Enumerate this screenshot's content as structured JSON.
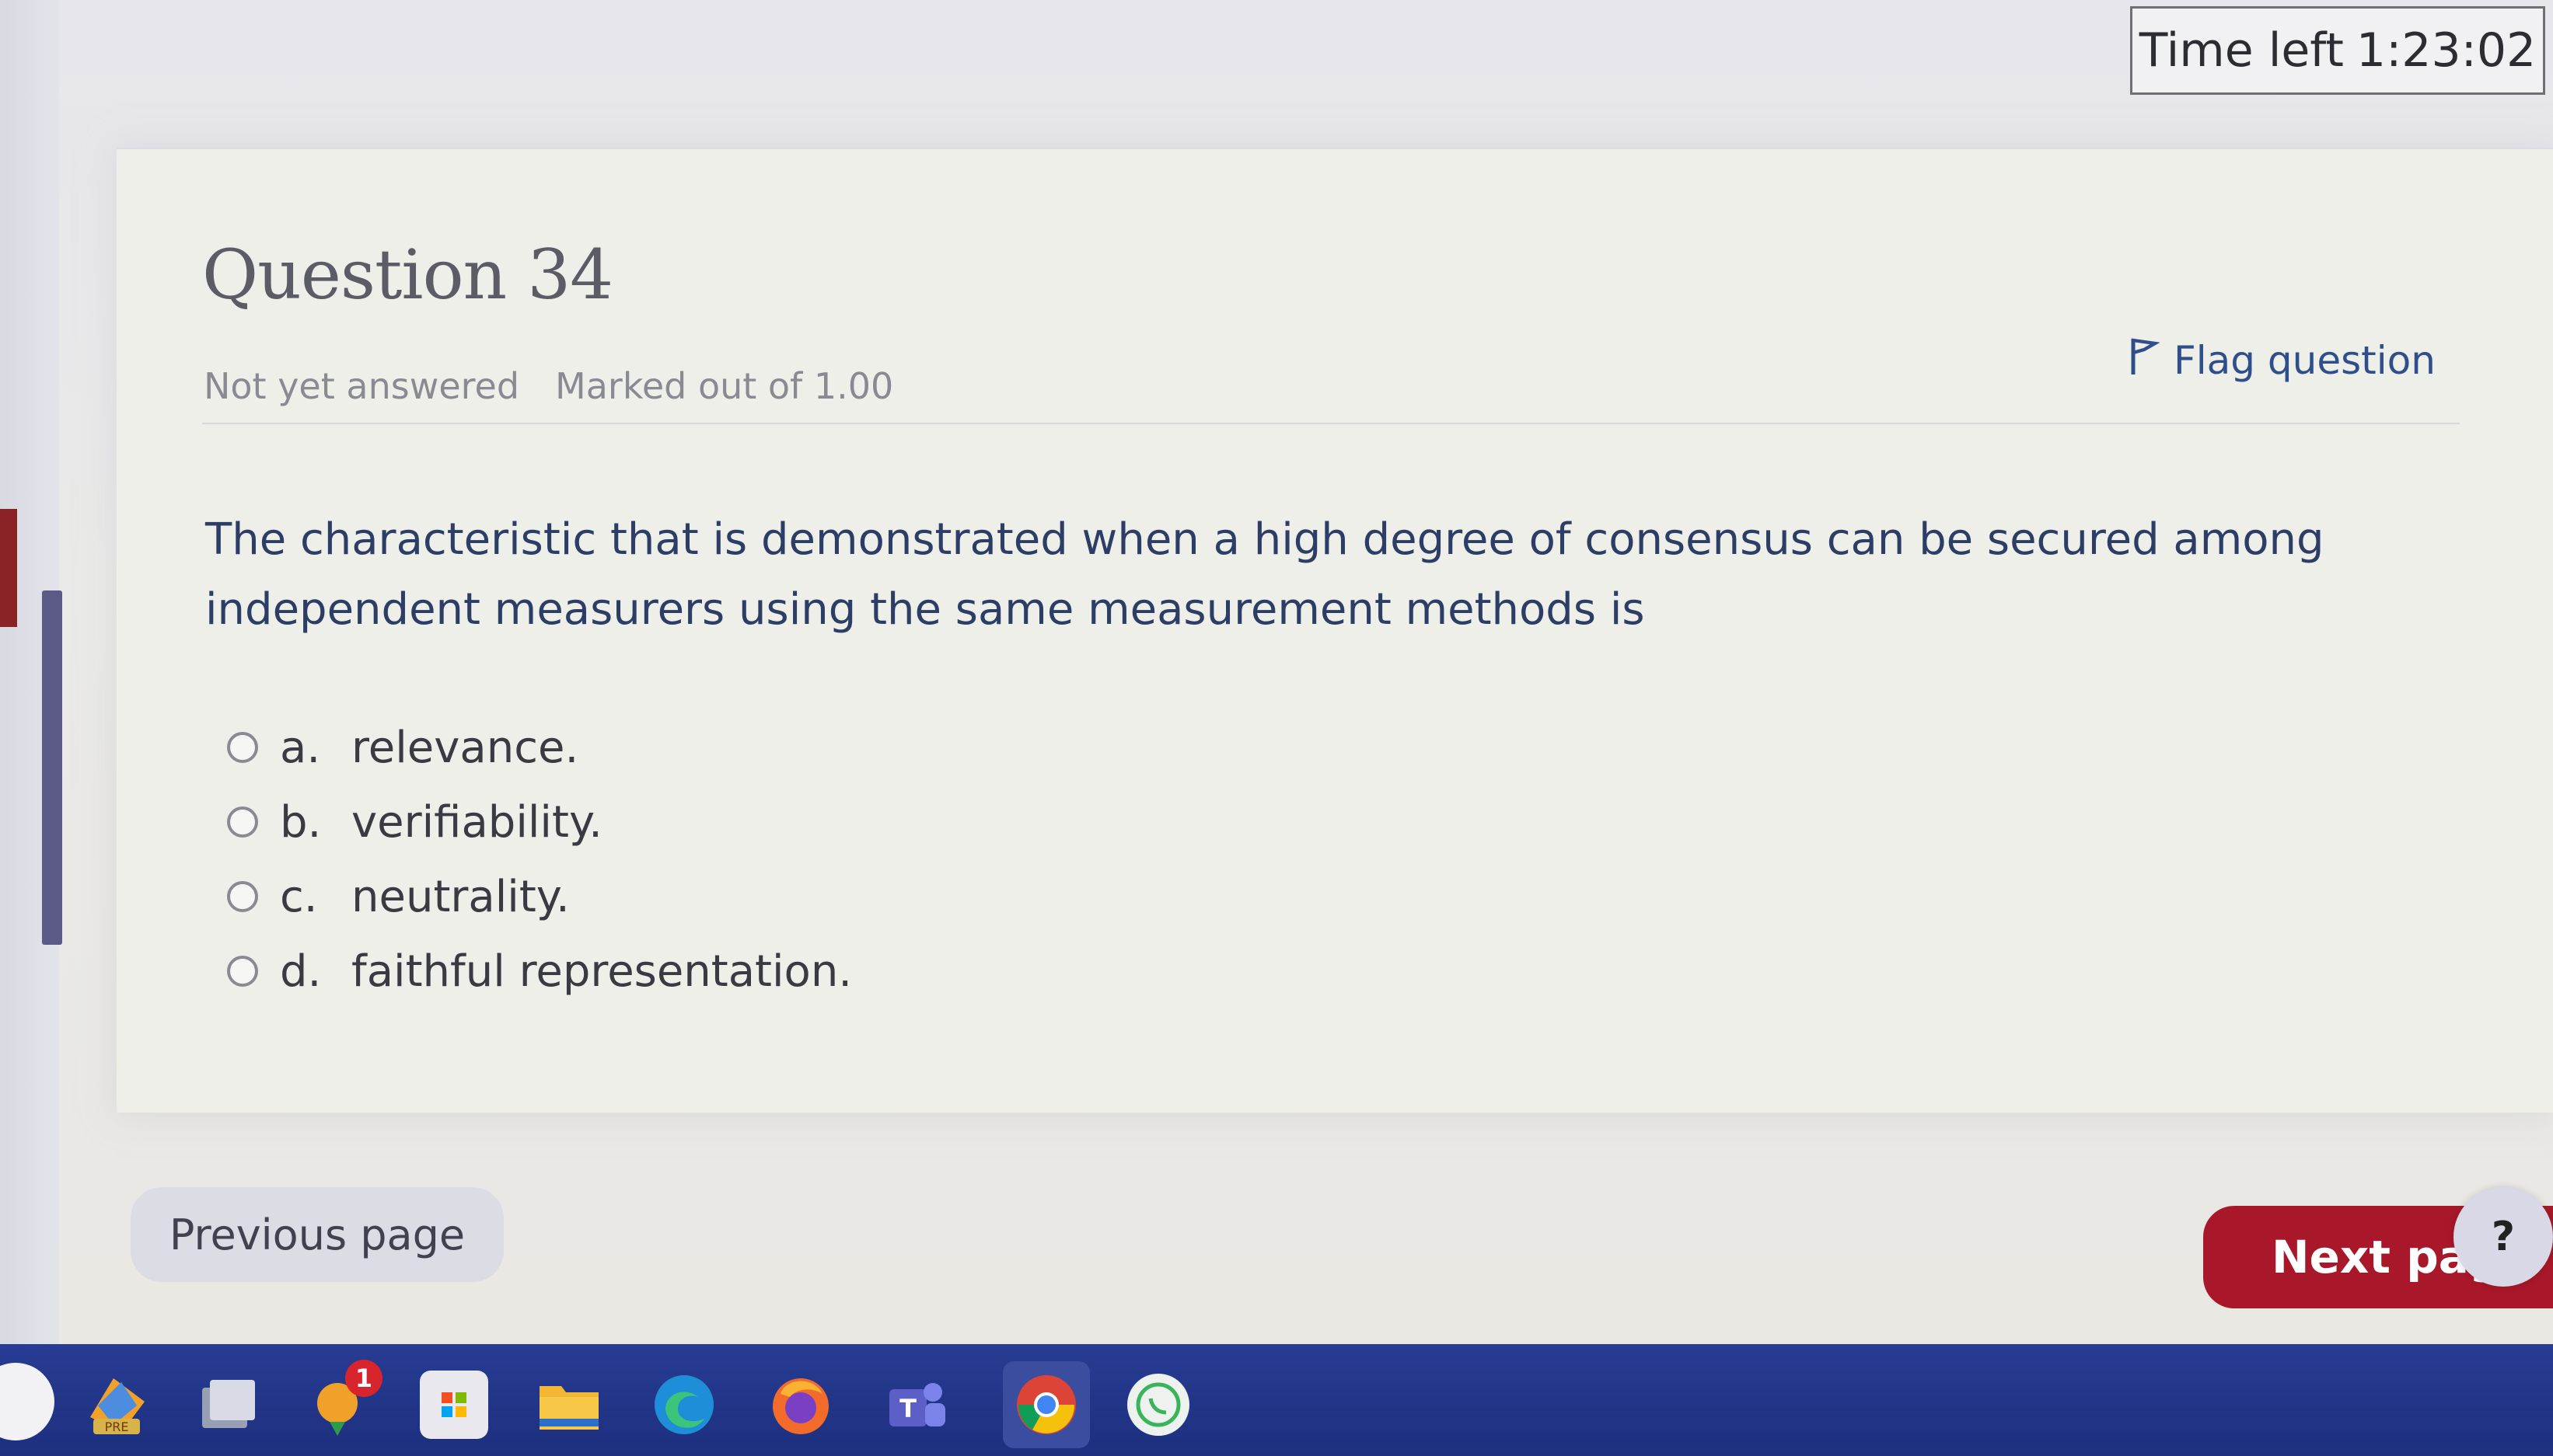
{
  "timer": {
    "label": "Time left",
    "value": "1:23:02"
  },
  "question": {
    "title": "Question 34",
    "status": "Not yet answered",
    "marked": "Marked out of 1.00",
    "flag_label": "Flag question",
    "text": "The characteristic that is demonstrated when a high degree of consensus can be secured among independent measurers using the same measurement methods is",
    "answers": [
      {
        "letter": "a.",
        "text": "relevance."
      },
      {
        "letter": "b.",
        "text": "verifiability."
      },
      {
        "letter": "c.",
        "text": "neutrality."
      },
      {
        "letter": "d.",
        "text": "faithful representation."
      }
    ]
  },
  "navigation": {
    "previous_label": "Previous page",
    "next_label": "Next pag",
    "help_label": "?"
  },
  "taskbar": {
    "badge_count": "1",
    "pre_label": "PRE",
    "icons": [
      "app-launcher-icon",
      "files-icon",
      "notifications-icon",
      "store-icon",
      "folder-icon",
      "edge-icon",
      "firefox-icon",
      "teams-icon",
      "chrome-icon",
      "whatsapp-icon"
    ]
  },
  "colors": {
    "accent_red": "#a8182a",
    "flag_blue": "#2e4f8a",
    "taskbar_blue": "#22368a"
  }
}
